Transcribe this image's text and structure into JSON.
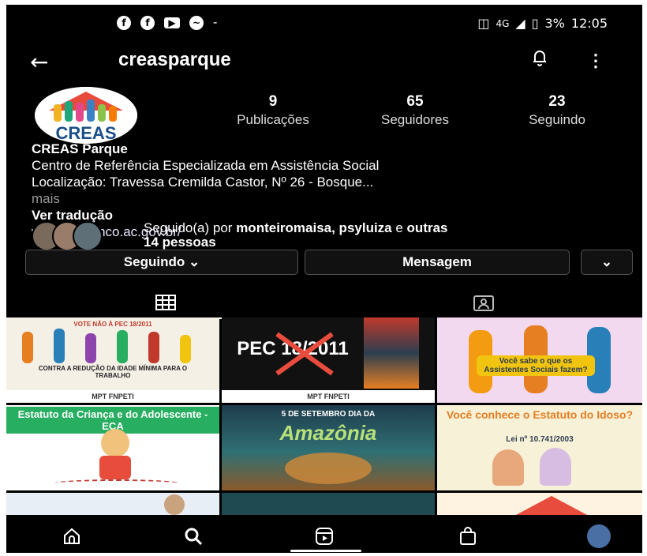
{
  "status_bar": {
    "left_icons": [
      "facebook-icon",
      "facebook-icon",
      "youtube-icon",
      "messenger-icon"
    ],
    "left_dash": "-",
    "network": "4G",
    "battery": "3%",
    "time": "12:05"
  },
  "header": {
    "back_icon": "←",
    "username": "creasparque",
    "kebab": "⋮"
  },
  "profile": {
    "avatar_text": "CREAS",
    "stats": [
      {
        "count": "9",
        "label": "Publicações"
      },
      {
        "count": "65",
        "label": "Seguidores"
      },
      {
        "count": "23",
        "label": "Seguindo"
      }
    ],
    "name": "CREAS Parque",
    "bio_line1": "Centro de Referência Especializada em Assistência Social",
    "bio_line2": "Localização: Travessa Cremilda Castor, Nº 26 - Bosque...",
    "more": "mais",
    "translate": "Ver tradução",
    "link": "www.riobranco.ac.gov.br/",
    "followed_prefix": "Seguido(a) por ",
    "followed_names": "monteiromaisa, psyluiza",
    "followed_and": " e ",
    "followed_others": "outras",
    "followed_count": "14 pessoas"
  },
  "buttons": {
    "following": "Seguindo ⌄",
    "message": "Mensagem",
    "more": "⌄"
  },
  "posts": [
    {
      "caption_top": "VOTE NÃO À PEC 18/2011",
      "caption_mid": "CONTRA A REDUÇÃO DA IDADE MÍNIMA PARA O TRABALHO",
      "footer": "MPT  FNPETI"
    },
    {
      "caption_big": "PEC 18/2011",
      "footer": "MPT  FNPETI"
    },
    {
      "caption_mid": "Você sabe o que os Assistentes Sociais fazem?"
    },
    {
      "caption_top": "Estatuto da Criança e do Adolescente - ECA"
    },
    {
      "caption_top": "5 DE SETEMBRO DIA DA",
      "caption_big": "Amazônia"
    },
    {
      "caption_top": "Você conhece o Estatuto do Idoso?",
      "caption_mid": "Lei nº 10.741/2003"
    }
  ],
  "colors": {
    "background": "#000000",
    "text": "#ffffff",
    "muted": "#9a9a9a",
    "border": "#555555"
  }
}
